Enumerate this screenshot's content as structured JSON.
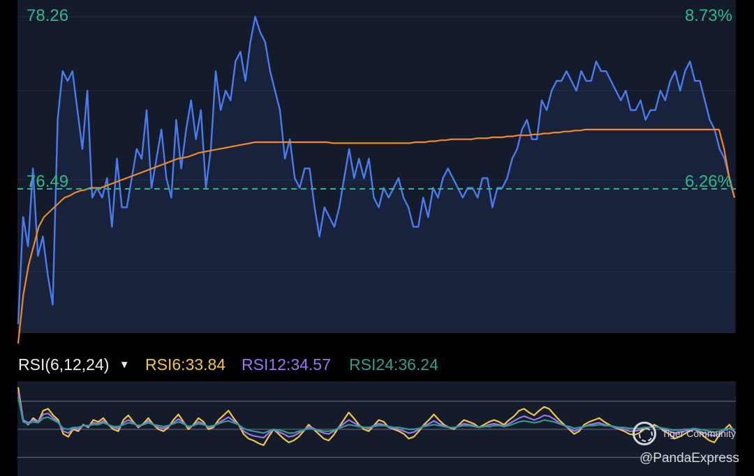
{
  "colors": {
    "background": "#000000",
    "panel": "#141b2b",
    "price_line": "#4a7cf0",
    "average_line": "#f28a20",
    "reference_line": "#2fb98a",
    "label_green": "#2fb98a",
    "rsi6": "#f3c83a",
    "rsi12": "#9d74f4",
    "rsi24": "#2e9e8e",
    "text_white": "#ececec"
  },
  "price_panel": {
    "left_top_label": "78.26",
    "left_ref_label": "76.49",
    "right_top_label": "8.73%",
    "right_ref_label": "6.26%"
  },
  "rsi_header": {
    "indicator": "RSI(6,12,24)",
    "dropdown_icon": "caret-down-icon",
    "rsi6": "RSI6:33.84",
    "rsi12": "RSI12:34.57",
    "rsi24": "RSI24:36.24"
  },
  "watermark": {
    "brand": "Tiger Community",
    "user": "@PandaExpress",
    "icon": "tiger-logo-icon"
  },
  "chart_data": [
    {
      "type": "line",
      "name": "intraday-price",
      "y_axis_left": {
        "top": 78.26,
        "reference": 76.49
      },
      "y_axis_right_percent": {
        "top": 8.73,
        "reference": 6.26
      },
      "reference_value": 76.49,
      "grid": "horizontal",
      "series": [
        {
          "values": [
            75.1,
            76.2,
            75.9,
            76.7,
            75.8,
            76.0,
            75.6,
            75.3,
            77.2,
            77.7,
            77.6,
            77.7,
            77.3,
            76.9,
            77.5,
            76.4,
            76.5,
            76.4,
            76.6,
            76.1,
            76.8,
            76.3,
            76.3,
            76.6,
            76.9,
            76.8,
            77.3,
            76.5,
            76.8,
            77.1,
            76.6,
            76.4,
            77.2,
            76.7,
            77.1,
            77.4,
            77.0,
            77.3,
            76.5,
            76.9,
            77.7,
            77.3,
            77.5,
            77.4,
            77.8,
            77.9,
            77.6,
            78.0,
            78.26,
            78.1,
            78.0,
            77.7,
            77.5,
            77.3,
            76.8,
            77.0,
            76.6,
            76.5,
            76.7,
            76.7,
            76.3,
            76.0,
            76.3,
            76.2,
            76.1,
            76.3,
            76.6,
            76.9,
            76.6,
            76.8,
            76.6,
            76.8,
            76.4,
            76.3,
            76.5,
            76.4,
            76.5,
            76.6,
            76.4,
            76.3,
            76.1,
            76.1,
            76.4,
            76.2,
            76.5,
            76.4,
            76.6,
            76.7,
            76.6,
            76.5,
            76.4,
            76.5,
            76.5,
            76.4,
            76.6,
            76.6,
            76.3,
            76.5,
            76.5,
            76.6,
            76.8,
            76.9,
            77.1,
            77.2,
            77.0,
            77.0,
            77.4,
            77.3,
            77.5,
            77.6,
            77.6,
            77.7,
            77.6,
            77.5,
            77.7,
            77.6,
            77.6,
            77.8,
            77.7,
            77.7,
            77.6,
            77.5,
            77.4,
            77.5,
            77.3,
            77.3,
            77.4,
            77.2,
            77.3,
            77.3,
            77.5,
            77.4,
            77.6,
            77.7,
            77.5,
            77.7,
            77.8,
            77.6,
            77.6,
            77.4,
            77.2,
            77.1,
            76.9,
            76.8,
            76.6,
            76.4
          ]
        },
        {
          "values": [
            74.9,
            75.4,
            75.7,
            75.9,
            76.1,
            76.2,
            76.25,
            76.3,
            76.35,
            76.4,
            76.42,
            76.45,
            76.47,
            76.48,
            76.5,
            76.5,
            76.5,
            76.52,
            76.54,
            76.56,
            76.58,
            76.6,
            76.62,
            76.64,
            76.66,
            76.68,
            76.7,
            76.72,
            76.74,
            76.76,
            76.78,
            76.8,
            76.81,
            76.82,
            76.84,
            76.86,
            76.87,
            76.88,
            76.89,
            76.9,
            76.91,
            76.92,
            76.93,
            76.94,
            76.95,
            76.96,
            76.97,
            76.97,
            76.97,
            76.97,
            76.97,
            76.97,
            76.97,
            76.97,
            76.97,
            76.97,
            76.97,
            76.97,
            76.97,
            76.97,
            76.97,
            76.96,
            76.96,
            76.96,
            76.96,
            76.96,
            76.96,
            76.96,
            76.96,
            76.96,
            76.96,
            76.96,
            76.96,
            76.96,
            76.96,
            76.96,
            76.96,
            76.97,
            76.97,
            76.97,
            76.98,
            76.98,
            76.99,
            76.99,
            77.0,
            77.0,
            77.0,
            77.0,
            77.0,
            77.01,
            77.01,
            77.01,
            77.02,
            77.02,
            77.02,
            77.03,
            77.03,
            77.04,
            77.04,
            77.04,
            77.05,
            77.05,
            77.06,
            77.06,
            77.07,
            77.07,
            77.08,
            77.08,
            77.09,
            77.09,
            77.1,
            77.1,
            77.1,
            77.1,
            77.1,
            77.1,
            77.1,
            77.1,
            77.1,
            77.1,
            77.1,
            77.1,
            77.1,
            77.1,
            77.1,
            77.1,
            77.1,
            77.1,
            77.1,
            77.1,
            77.1,
            77.1,
            77.1,
            77.1,
            77.1,
            77.1,
            77.1,
            76.9,
            76.6,
            76.4
          ]
        }
      ]
    },
    {
      "type": "line",
      "name": "RSI(6,12,24)",
      "grid": "horizontal",
      "series": [
        {
          "name": "RSI6",
          "values": [
            95,
            60,
            55,
            62,
            58,
            70,
            72,
            65,
            60,
            45,
            42,
            50,
            48,
            55,
            52,
            60,
            58,
            62,
            55,
            50,
            48,
            60,
            65,
            58,
            52,
            56,
            62,
            55,
            50,
            48,
            52,
            60,
            66,
            58,
            50,
            55,
            62,
            58,
            50,
            52,
            60,
            65,
            70,
            62,
            55,
            45,
            40,
            38,
            35,
            33,
            42,
            50,
            45,
            40,
            36,
            38,
            42,
            48,
            55,
            50,
            45,
            40,
            38,
            44,
            52,
            60,
            68,
            62,
            55,
            50,
            48,
            54,
            60,
            58,
            52,
            50,
            48,
            45,
            40,
            42,
            48,
            55,
            60,
            66,
            60,
            55,
            52,
            50,
            55,
            60,
            58,
            56,
            52,
            55,
            58,
            60,
            58,
            55,
            60,
            64,
            70,
            72,
            68,
            65,
            70,
            74,
            72,
            66,
            60,
            55,
            50,
            45,
            48,
            55,
            58,
            60,
            62,
            58,
            55,
            52,
            50,
            48,
            45,
            44,
            46,
            50,
            52,
            55,
            52,
            48,
            45,
            40,
            42,
            45,
            48,
            50,
            47,
            42,
            38,
            36,
            44,
            50,
            55,
            47
          ]
        },
        {
          "name": "RSI12",
          "values": [
            90,
            60,
            57,
            60,
            58,
            66,
            67,
            62,
            58,
            48,
            46,
            51,
            50,
            54,
            53,
            57,
            56,
            59,
            55,
            52,
            51,
            57,
            60,
            57,
            53,
            55,
            59,
            55,
            52,
            51,
            53,
            57,
            61,
            57,
            52,
            54,
            58,
            56,
            52,
            53,
            57,
            60,
            63,
            59,
            55,
            48,
            45,
            43,
            42,
            41,
            46,
            50,
            47,
            45,
            42,
            43,
            46,
            49,
            53,
            51,
            48,
            46,
            45,
            48,
            52,
            56,
            60,
            57,
            54,
            52,
            51,
            54,
            56,
            55,
            52,
            51,
            50,
            48,
            46,
            47,
            50,
            54,
            56,
            59,
            56,
            54,
            52,
            51,
            54,
            56,
            55,
            54,
            52,
            53,
            55,
            56,
            55,
            54,
            56,
            59,
            62,
            64,
            62,
            60,
            62,
            65,
            64,
            61,
            57,
            54,
            51,
            48,
            50,
            53,
            55,
            56,
            57,
            55,
            54,
            52,
            51,
            50,
            48,
            48,
            49,
            51,
            52,
            53,
            52,
            50,
            48,
            46,
            47,
            48,
            49,
            50,
            48,
            46,
            44,
            43,
            46,
            49,
            51,
            48
          ]
        },
        {
          "name": "RSI24",
          "values": [
            85,
            58,
            56,
            58,
            57,
            62,
            63,
            60,
            57,
            51,
            50,
            52,
            52,
            54,
            54,
            55,
            55,
            57,
            55,
            53,
            53,
            55,
            57,
            56,
            54,
            55,
            57,
            55,
            54,
            53,
            54,
            56,
            58,
            56,
            53,
            54,
            56,
            55,
            53,
            54,
            56,
            58,
            59,
            57,
            55,
            51,
            49,
            48,
            47,
            46,
            48,
            50,
            49,
            48,
            46,
            46,
            48,
            49,
            51,
            50,
            49,
            48,
            48,
            49,
            51,
            53,
            55,
            54,
            53,
            52,
            52,
            53,
            54,
            54,
            53,
            52,
            52,
            51,
            50,
            50,
            51,
            53,
            54,
            55,
            54,
            53,
            52,
            52,
            53,
            54,
            54,
            53,
            52,
            53,
            53,
            54,
            54,
            53,
            54,
            56,
            58,
            59,
            58,
            57,
            58,
            60,
            59,
            58,
            56,
            54,
            53,
            51,
            52,
            53,
            54,
            54,
            55,
            54,
            54,
            53,
            52,
            52,
            51,
            51,
            51,
            52,
            52,
            53,
            52,
            51,
            50,
            49,
            49,
            50,
            50,
            51,
            50,
            49,
            48,
            47,
            48,
            50,
            51,
            50
          ]
        }
      ]
    }
  ]
}
